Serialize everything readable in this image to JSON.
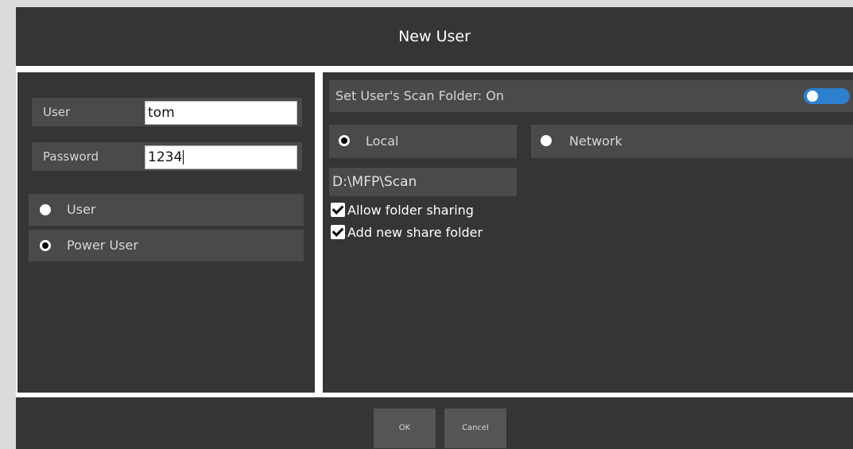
{
  "window": {
    "title": "New User"
  },
  "account": {
    "user_label": "User",
    "user_value": "tom",
    "password_label": "Password",
    "password_value": "1234",
    "role_options": [
      {
        "label": "User",
        "selected": false
      },
      {
        "label": "Power User",
        "selected": true
      }
    ]
  },
  "scan_folder": {
    "header_label": "Set User's Scan Folder: On",
    "toggle_on": true,
    "location_options": [
      {
        "label": "Local",
        "selected": true
      },
      {
        "label": "Network",
        "selected": false
      }
    ],
    "path": "D:\\MFP\\Scan",
    "checkboxes": [
      {
        "label": "Allow folder sharing",
        "checked": true
      },
      {
        "label": "Add new share folder",
        "checked": true
      }
    ]
  },
  "footer": {
    "ok_label": "OK",
    "cancel_label": "Cancel"
  },
  "colors": {
    "panel_bg": "#353535",
    "row_bg": "#4a4a4a",
    "toggle_accent": "#2f7fd0"
  },
  "icons": {
    "radio_selected": "radio-selected-icon",
    "radio_unselected": "radio-unselected-icon",
    "checkbox_checked": "checkbox-checked-icon"
  }
}
